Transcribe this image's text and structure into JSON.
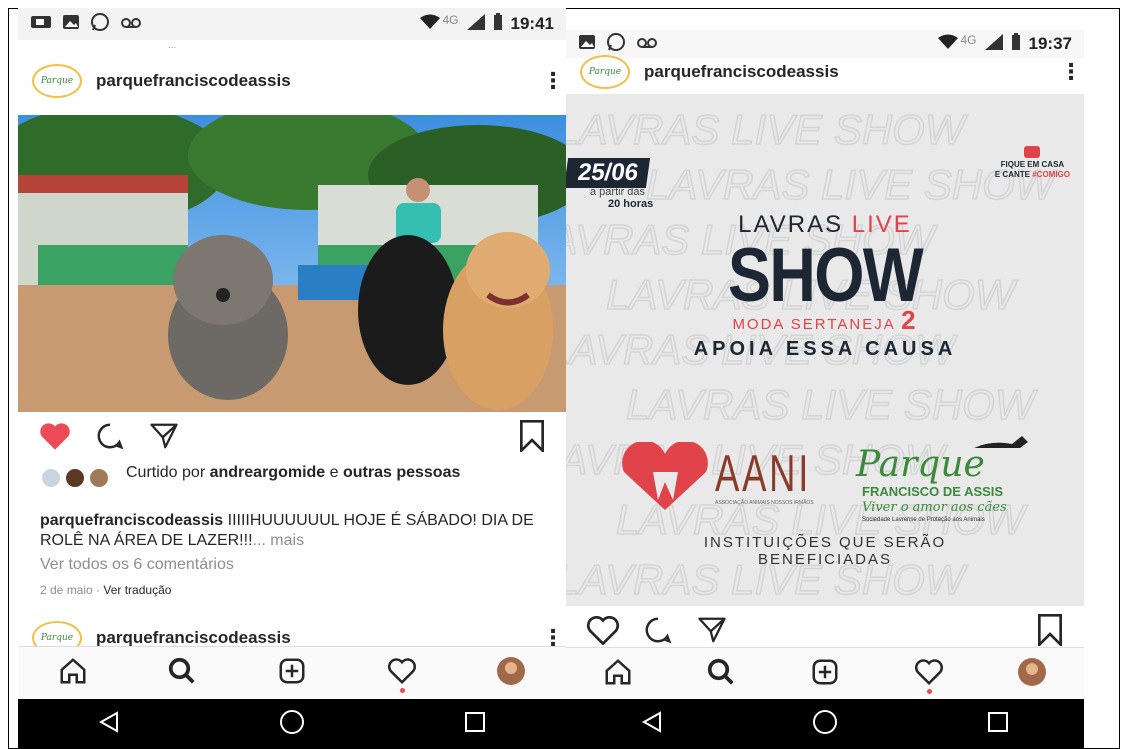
{
  "left": {
    "status": {
      "time": "19:41",
      "network": "4G"
    },
    "top_hint": "...",
    "post": {
      "username": "parquefranciscodeassis",
      "logo_text": "Parque",
      "liked_prefix": "Curtido por ",
      "liked_user": "andreargomide",
      "liked_mid": " e ",
      "liked_rest": "outras pessoas",
      "caption_user": "parquefranciscodeassis",
      "caption_text": " IIIIIHUUUUUUL HOJE É SÁBADO! DIA DE ROLÊ NA ÁREA DE LAZER!!!",
      "caption_more": "... mais",
      "view_comments": "Ver todos os 6 comentários",
      "date": "2 de maio",
      "translate": "Ver tradução"
    },
    "next_username": "parquefranciscodeassis"
  },
  "right": {
    "status": {
      "time": "19:37",
      "network": "4G"
    },
    "post": {
      "username": "parquefranciscodeassis",
      "logo_text": "Parque",
      "poster": {
        "bg_words": "LAVRAS LIVE SHOW",
        "date": "25/06",
        "time_prefix": "a partir das",
        "time": "20 horas",
        "top_right_1": "FIQUE EM CASA",
        "top_right_2": "E CANTE",
        "top_right_tag": "#COMIGO",
        "title_a": "LAVRAS",
        "title_b": "LIVE",
        "title_show": "SHOW",
        "subtitle": "MODA SERTANEJA",
        "subtitle_num": "2",
        "cause": "APOIA ESSA CAUSA",
        "aani": "AANI",
        "aani_sub": "ASSOCIAÇÃO ANIMAIS NOSSOS IRMÃOS",
        "parque": "Parque",
        "parque_sub": "FRANCISCO DE ASSIS",
        "parque_slogan": "Viver o amor aos cães",
        "parque_small": "Sociedade Lavrense de Proteção aos Animais",
        "benef_1": "INSTITUIÇÕES QUE SERÃO",
        "benef_2": "BENEFICIADAS"
      }
    }
  },
  "colors": {
    "heart": "#ed4956",
    "poster_red": "#e0444a",
    "poster_dark": "#1d2733",
    "parque_green": "#3a8a3a"
  }
}
